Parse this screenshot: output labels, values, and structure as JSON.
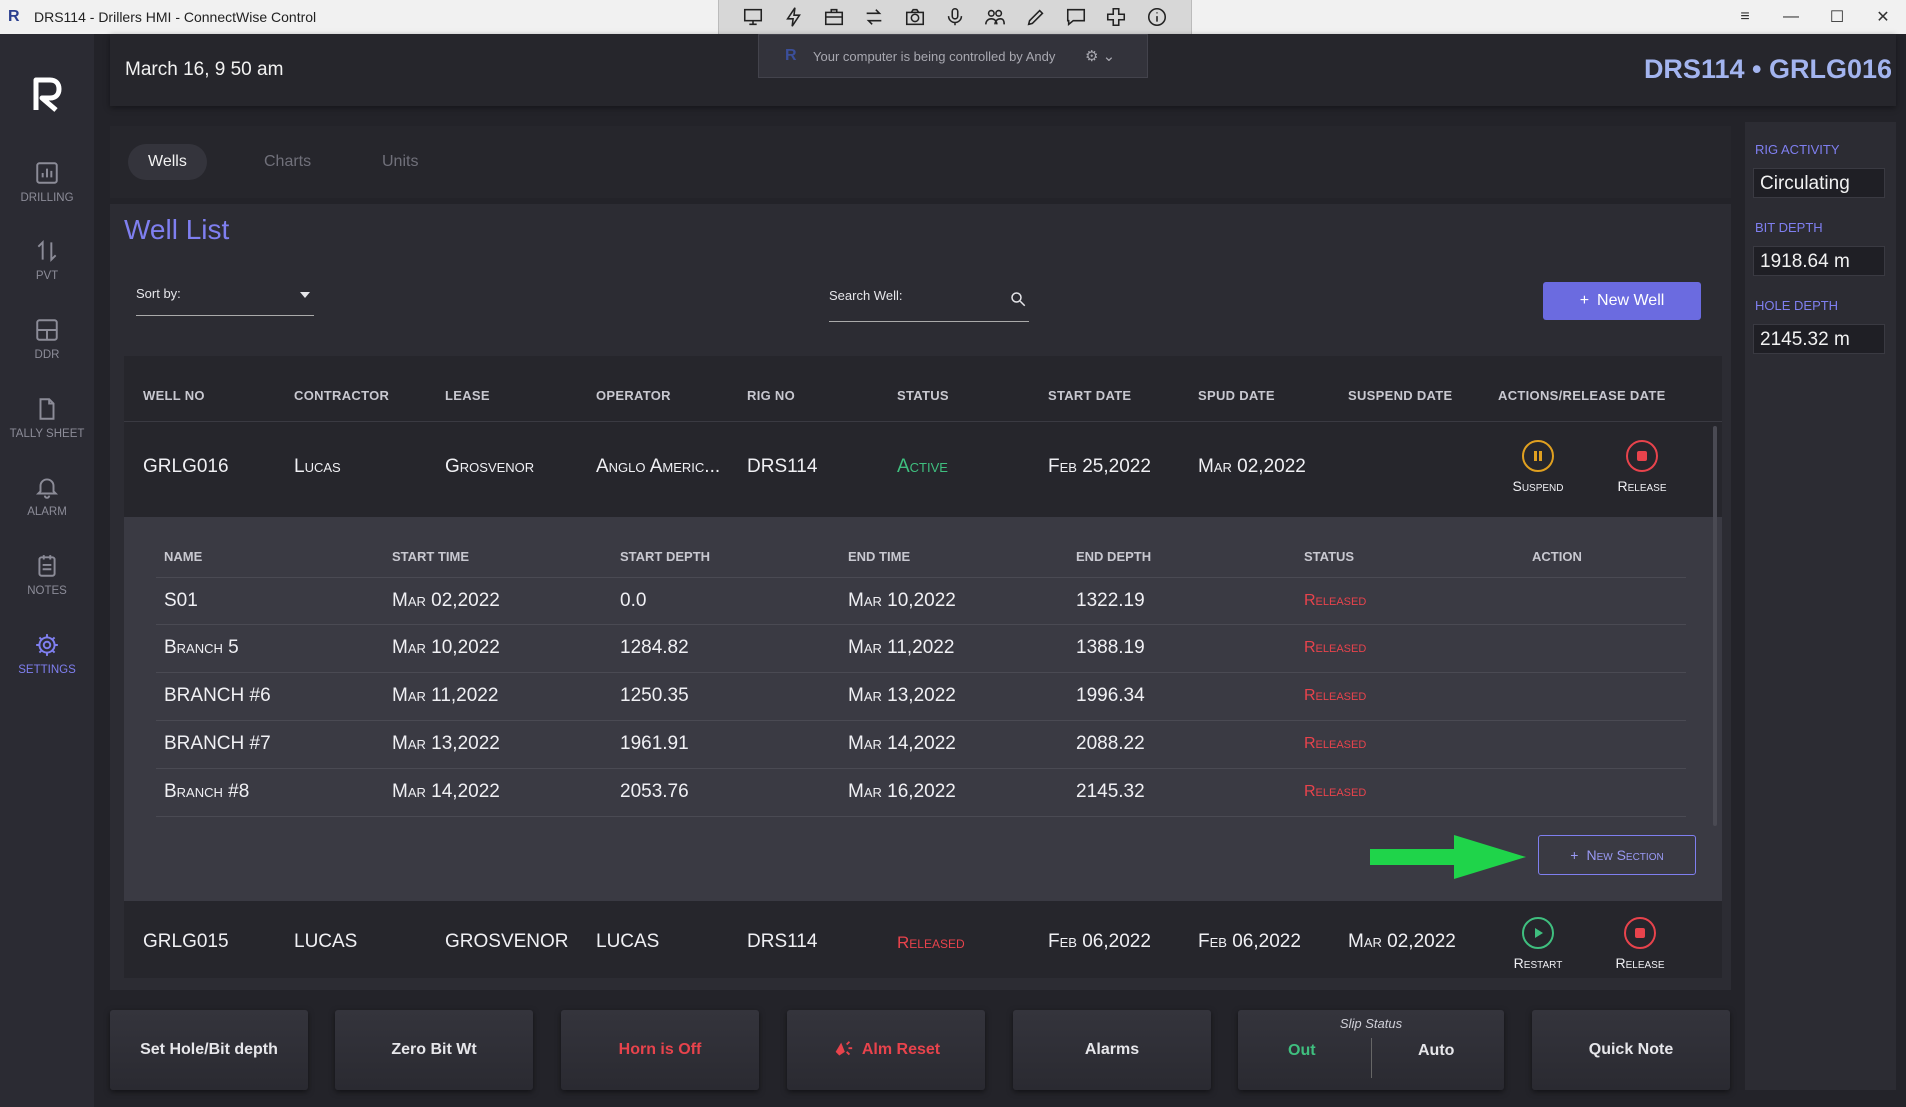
{
  "window": {
    "title": "DRS114 - Drillers HMI - ConnectWise Control",
    "app_icon": "R",
    "toolbar_icons": [
      "monitor-icon",
      "lightning-icon",
      "briefcase-icon",
      "swap-icon",
      "camera-icon",
      "microphone-icon",
      "users-icon",
      "pencil-icon",
      "chat-icon",
      "move-icon",
      "info-icon"
    ],
    "controls": {
      "menu": "≡",
      "minimize": "—",
      "maximize": "☐",
      "close": "✕"
    }
  },
  "banner": {
    "logo": "R",
    "text": "Your computer is being controlled by Andy",
    "gear": "⚙ ⌄"
  },
  "header": {
    "date": "March 16, 9 50 am",
    "ident": "DRS114 • GRLG016"
  },
  "nav": [
    {
      "label": "DRILLING",
      "icon": "bar-chart-icon"
    },
    {
      "label": "PVT",
      "icon": "arrows-up-down-icon"
    },
    {
      "label": "DDR",
      "icon": "layout-icon"
    },
    {
      "label": "TALLY SHEET",
      "icon": "document-icon"
    },
    {
      "label": "ALARM",
      "icon": "bell-icon"
    },
    {
      "label": "NOTES",
      "icon": "notes-icon"
    },
    {
      "label": "SETTINGS",
      "icon": "gear-icon",
      "active": true
    }
  ],
  "tabs": [
    {
      "label": "Wells",
      "active": true
    },
    {
      "label": "Charts"
    },
    {
      "label": "Units"
    }
  ],
  "page": {
    "title": "Well List",
    "sort_label": "Sort by:",
    "search_label": "Search Well:",
    "new_well": "New Well"
  },
  "table": {
    "headers": [
      "WELL NO",
      "CONTRACTOR",
      "LEASE",
      "OPERATOR",
      "RIG NO",
      "STATUS",
      "START DATE",
      "SPUD DATE",
      "SUSPEND DATE",
      "ACTIONS/RELEASE DATE"
    ],
    "wells": [
      {
        "well_no": "GRLG016",
        "contractor": "Lucas",
        "lease": "Grosvenor",
        "operator": "Anglo Americ...",
        "rig_no": "DRS114",
        "status": "Active",
        "start_date": "Feb 25,2022",
        "spud_date": "Mar 02,2022",
        "suspend_date": "",
        "actions": [
          "Suspend",
          "Release"
        ]
      },
      {
        "well_no": "GRLG015",
        "contractor": "LUCAS",
        "lease": "GROSVENOR",
        "operator": "LUCAS",
        "rig_no": "DRS114",
        "status": "Released",
        "start_date": "Feb 06,2022",
        "spud_date": "Feb 06,2022",
        "suspend_date": "Mar 02,2022",
        "actions": [
          "Restart",
          "Release"
        ]
      }
    ],
    "sections": {
      "headers": [
        "NAME",
        "START TIME",
        "START DEPTH",
        "END TIME",
        "END DEPTH",
        "STATUS",
        "ACTION"
      ],
      "rows": [
        {
          "name": "S01",
          "start_time": "Mar 02,2022",
          "start_depth": "0.0",
          "end_time": "Mar 10,2022",
          "end_depth": "1322.19",
          "status": "Released"
        },
        {
          "name": "Branch 5",
          "start_time": "Mar 10,2022",
          "start_depth": "1284.82",
          "end_time": "Mar 11,2022",
          "end_depth": "1388.19",
          "status": "Released"
        },
        {
          "name": "BRANCH #6",
          "start_time": "Mar 11,2022",
          "start_depth": "1250.35",
          "end_time": "Mar 13,2022",
          "end_depth": "1996.34",
          "status": "Released"
        },
        {
          "name": "BRANCH #7",
          "start_time": "Mar 13,2022",
          "start_depth": "1961.91",
          "end_time": "Mar 14,2022",
          "end_depth": "2088.22",
          "status": "Released"
        },
        {
          "name": "Branch #8",
          "start_time": "Mar 14,2022",
          "start_depth": "2053.76",
          "end_time": "Mar 16,2022",
          "end_depth": "2145.32",
          "status": "Released"
        }
      ],
      "new_section": "New Section"
    }
  },
  "bottom": {
    "set_depth": "Set Hole/Bit depth",
    "zero_bit": "Zero Bit Wt",
    "horn": "Horn is Off",
    "alm_reset": "Alm Reset",
    "alarms": "Alarms",
    "slip_title": "Slip Status",
    "slip_out": "Out",
    "slip_auto": "Auto",
    "quick_note": "Quick Note"
  },
  "right": {
    "rig_activity_label": "RIG ACTIVITY",
    "rig_activity": "Circulating",
    "bit_depth_label": "BIT DEPTH",
    "bit_depth": "1918.64 m",
    "hole_depth_label": "HOLE DEPTH",
    "hole_depth": "2145.32 m"
  },
  "colors": {
    "accent": "#7f7ff0",
    "active": "#3fbf7f",
    "released": "#e8434c",
    "suspend": "#e0a020"
  }
}
